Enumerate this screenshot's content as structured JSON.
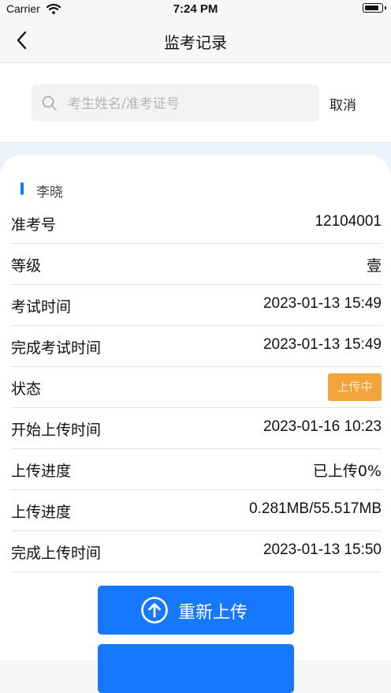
{
  "status_bar": {
    "carrier": "Carrier",
    "time": "7:24 PM"
  },
  "nav": {
    "title": "监考记录"
  },
  "search": {
    "placeholder": "考生姓名/准考证号",
    "value": "",
    "cancel_label": "取消"
  },
  "card": {
    "student_name": "李晓",
    "rows": [
      {
        "label": "准考号",
        "value": "12104001"
      },
      {
        "label": "等级",
        "value": "壹"
      },
      {
        "label": "考试时间",
        "value": "2023-01-13 15:49"
      },
      {
        "label": "完成考试时间",
        "value": "2023-01-13 15:49"
      },
      {
        "label": "状态",
        "value": "上传中"
      },
      {
        "label": "开始上传时间",
        "value": "2023-01-16 10:23"
      },
      {
        "label": "上传进度",
        "value": "已上传0%"
      },
      {
        "label": "上传进度",
        "value": "0.281MB/55.517MB"
      },
      {
        "label": "完成上传时间",
        "value": "2023-01-13 15:50"
      }
    ]
  },
  "actions": {
    "reupload_label": "重新上传"
  },
  "colors": {
    "accent": "#1677ff",
    "status_uploading": "#f2a33a",
    "band": "#eaf3fb"
  }
}
